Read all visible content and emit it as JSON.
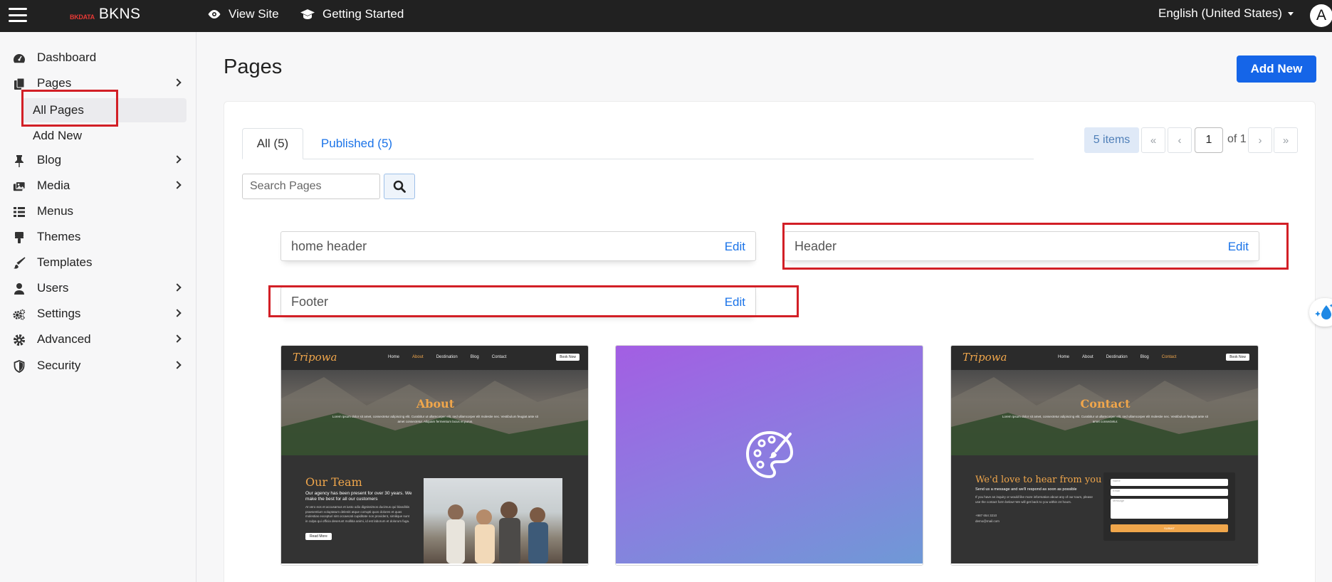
{
  "topbar": {
    "brand_mark": "BKDATA",
    "brand_name": "BKNS",
    "view_site": "View Site",
    "getting_started": "Getting Started",
    "language": "English (United States)",
    "avatar_letter": "A"
  },
  "sidebar": {
    "items": [
      {
        "label": "Dashboard",
        "icon": "dashboard-icon"
      },
      {
        "label": "Pages",
        "icon": "pages-icon",
        "has_children": true
      },
      {
        "label": "All Pages",
        "sub": true,
        "active": true
      },
      {
        "label": "Add New",
        "sub": true
      },
      {
        "label": "Blog",
        "icon": "pin-icon",
        "has_children": true
      },
      {
        "label": "Media",
        "icon": "media-icon",
        "has_children": true
      },
      {
        "label": "Menus",
        "icon": "list-icon"
      },
      {
        "label": "Themes",
        "icon": "brush-icon"
      },
      {
        "label": "Templates",
        "icon": "paintbrush-icon"
      },
      {
        "label": "Users",
        "icon": "user-icon",
        "has_children": true
      },
      {
        "label": "Settings",
        "icon": "cogs-icon",
        "has_children": true
      },
      {
        "label": "Advanced",
        "icon": "gear-icon",
        "has_children": true
      },
      {
        "label": "Security",
        "icon": "shield-icon",
        "has_children": true
      }
    ]
  },
  "main": {
    "title": "Pages",
    "add_new": "Add New",
    "tabs": [
      {
        "label": "All (5)",
        "active": true
      },
      {
        "label": "Published (5)",
        "active": false
      }
    ],
    "pagination": {
      "items": "5 items",
      "first": "«",
      "prev": "‹",
      "current_page": "1",
      "of_pages": "of 1",
      "next": "›",
      "last": "»"
    },
    "search": {
      "placeholder": "Search Pages"
    },
    "parts": [
      {
        "name": "home header",
        "edit": "Edit"
      },
      {
        "name": "Header",
        "edit": "Edit"
      },
      {
        "name": "Footer",
        "edit": "Edit"
      }
    ],
    "thumbnails": [
      {
        "brand": "Tripowa",
        "menu": [
          "Home",
          "About",
          "Destination",
          "Blog",
          "Contact"
        ],
        "book": "Book Now",
        "hero_title": "About",
        "hero_sub": "Lorem ipsum dolor sit amet, consectetur adipiscing elit. Curabitur ut ullamcorper elit, sed ullamcorper elit molestie nec. Vestibulum feugiat ante sit amet consectetur. Aliquam fermentum lacus et purus.",
        "section_title": "Our Team",
        "lead": "Our agency has been present for over 30 years. We make the best for all our customers",
        "para": "At vero eos et accusamus et iusto odio dignissimos ducimus qui blanditiis praesentium voluptatum deleniti atque corrupti quos dolores et quas molestias excepturi sint occaecati cupiditate non provident, similique sunt in culpa qui officia deserunt mollitia animi, id est laborum et dolorum fuga.",
        "button": "Read More"
      },
      {
        "icon": "palette-icon"
      },
      {
        "brand": "Tripowa",
        "menu": [
          "Home",
          "About",
          "Destination",
          "Blog",
          "Contact"
        ],
        "book": "Book Now",
        "hero_title": "Contact",
        "hero_sub": "Lorem ipsum dolor sit amet, consectetur adipiscing elit. Curabitur ut ullamcorper elit, sed ullamcorper elit molestie nec. Vestibulum feugiat ante sit amet consectetur.",
        "section_title": "We'd love to hear from you",
        "lead": "Send us a message and we'll respond as soon as possible",
        "para": "If you have an inquiry or would like more information about any of our tours, please use the contact form below! We will get back to you within 24 hours.",
        "phone": "+987 654 3210",
        "email": "demo@mail.com",
        "form_name": "Name",
        "form_email": "Email",
        "form_message": "Message",
        "submit": "SUBMIT"
      }
    ]
  },
  "colors": {
    "primary": "#1565e8",
    "topbar": "#212121",
    "highlight": "#d21f26",
    "link": "#1a73e8"
  }
}
